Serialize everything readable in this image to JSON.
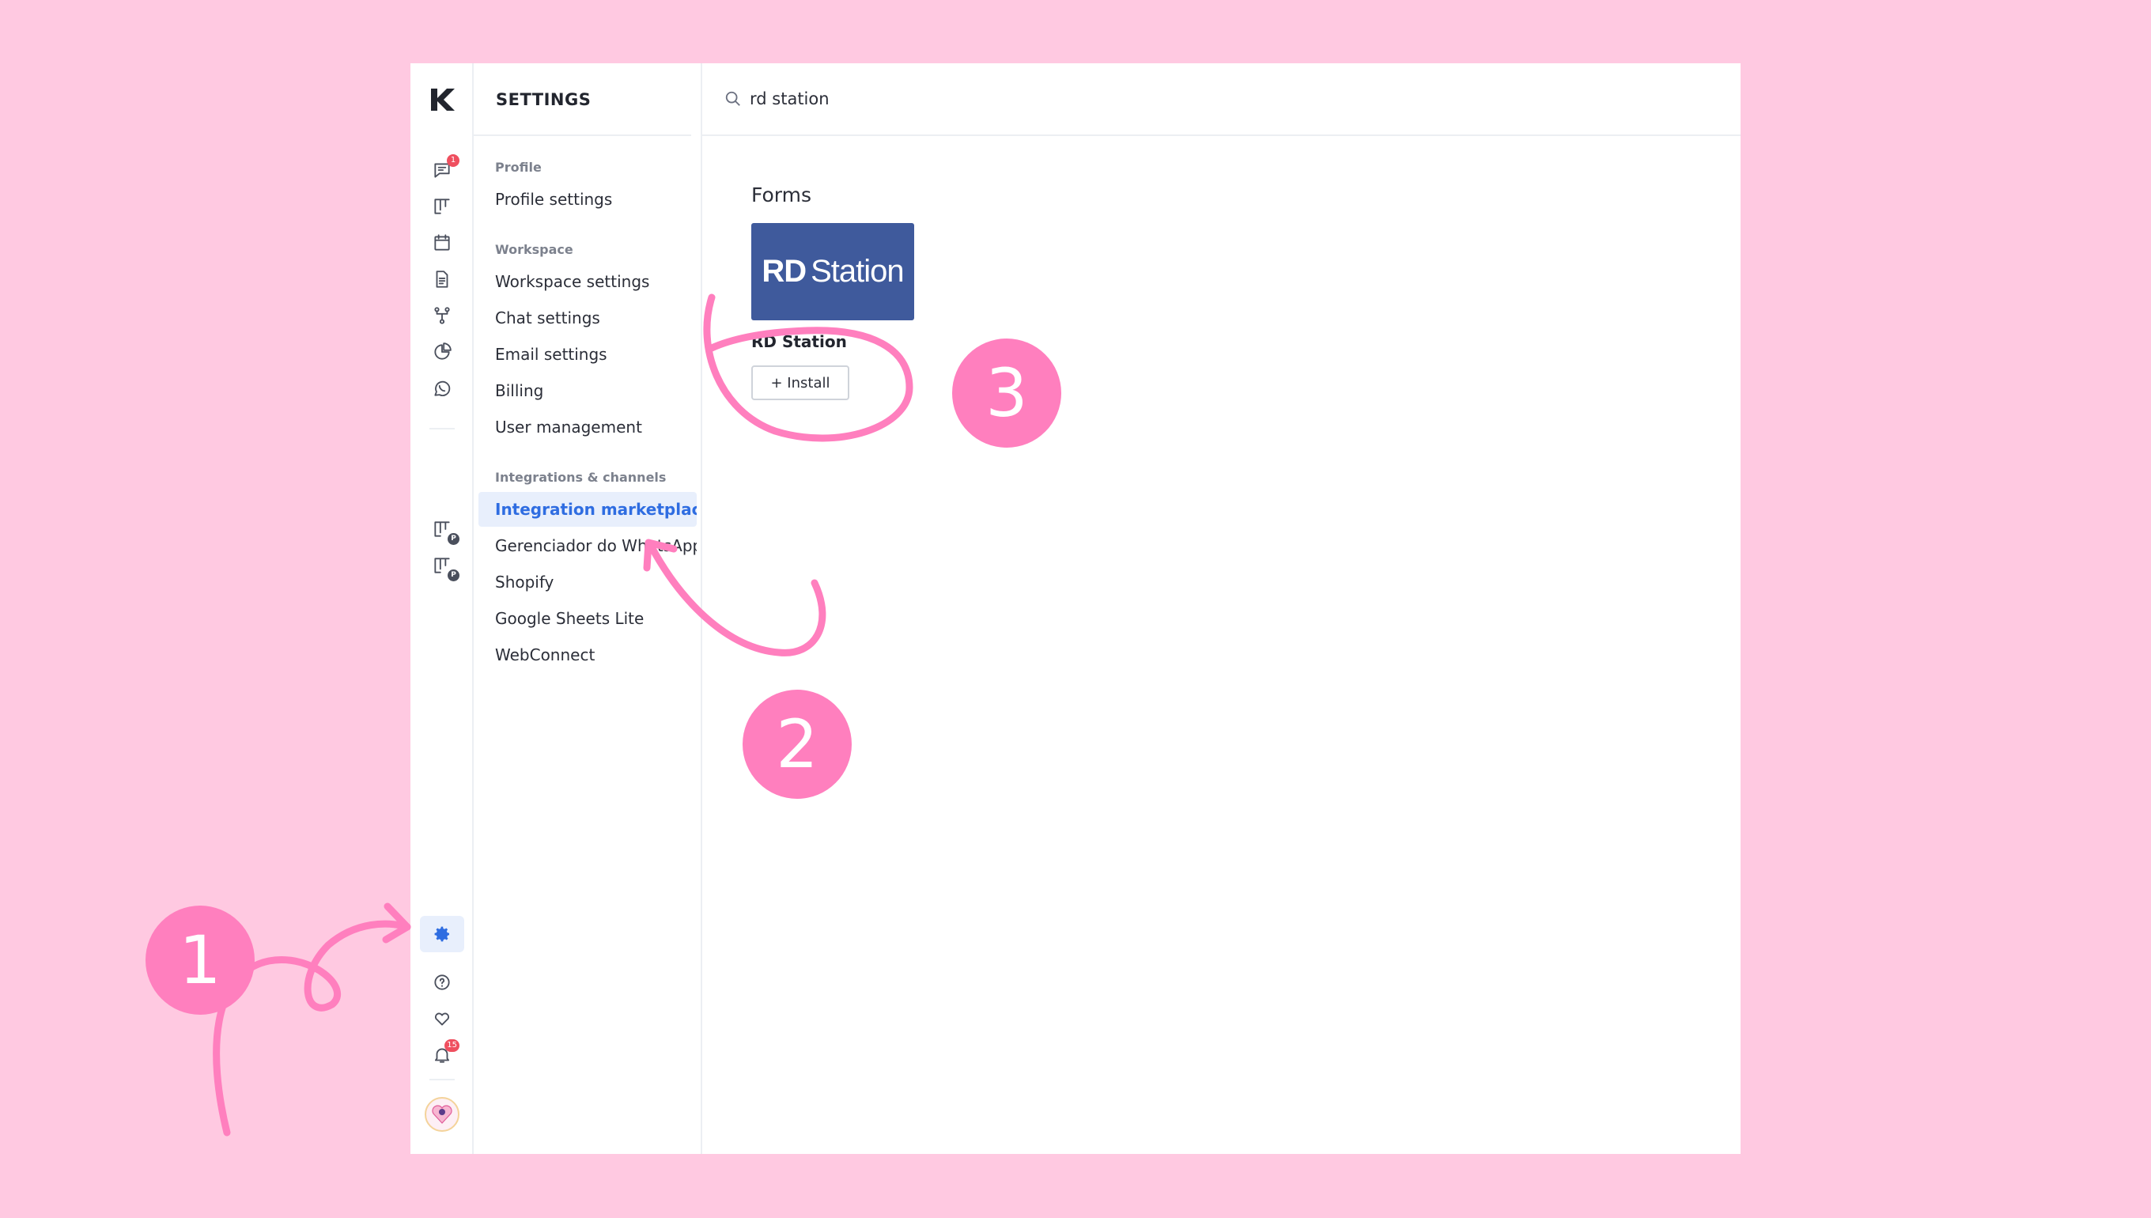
{
  "rail": {
    "chat_badge": "1",
    "notifications_badge": "15",
    "pipeline_badge_letter": "P"
  },
  "settings_nav": {
    "title": "SETTINGS",
    "groups": [
      {
        "label": "Profile",
        "items": [
          "Profile settings"
        ]
      },
      {
        "label": "Workspace",
        "items": [
          "Workspace settings",
          "Chat settings",
          "Email settings",
          "Billing",
          "User management"
        ]
      },
      {
        "label": "Integrations & channels",
        "items": [
          "Integration marketplace",
          "Gerenciador do WhatsApp",
          "Shopify",
          "Google Sheets Lite",
          "WebConnect"
        ]
      }
    ]
  },
  "search": {
    "value": "rd station"
  },
  "main": {
    "section_heading": "Forms",
    "integration": {
      "logo_bold": "RD",
      "logo_rest": "Station",
      "name": "RD Station",
      "install_label": "+ Install"
    }
  },
  "annotations": {
    "step1": "1",
    "step2": "2",
    "step3": "3"
  },
  "colors": {
    "background": "#ffc9e1",
    "accent": "#2f6de1",
    "annotation": "#ff7fbe",
    "brand_logo": "#3f5a9c"
  }
}
